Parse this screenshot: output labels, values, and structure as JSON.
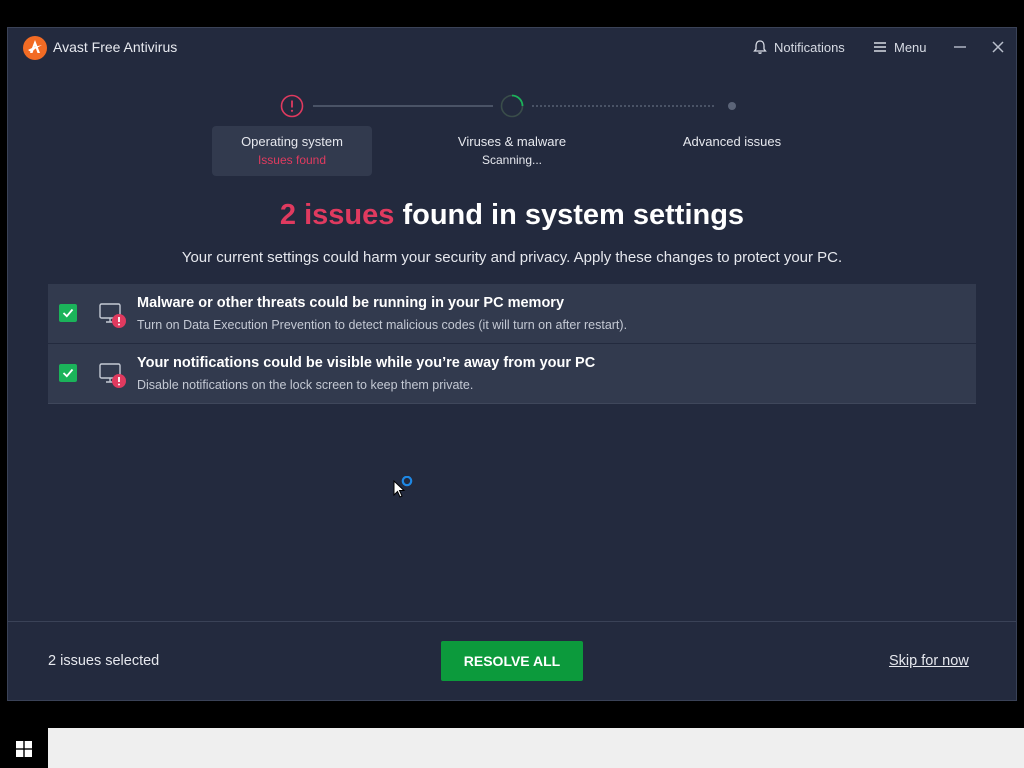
{
  "app": {
    "title": "Avast Free Antivirus"
  },
  "titlebar": {
    "notifications": "Notifications",
    "menu": "Menu"
  },
  "steps": [
    {
      "label": "Operating system",
      "sub": "Issues found",
      "sub_color": "#e03a5f",
      "status": "warning"
    },
    {
      "label": "Viruses & malware",
      "sub": "Scanning...",
      "sub_color": "#e6e8ee",
      "status": "in-progress"
    },
    {
      "label": "Advanced issues",
      "sub": "",
      "status": "pending"
    }
  ],
  "headline": {
    "highlight": "2 issues",
    "rest": " found in system settings"
  },
  "subline": "Your current settings could harm your security and privacy. Apply these changes to protect your PC.",
  "issues": [
    {
      "title": "Malware or other threats could be running in your PC memory",
      "desc": "Turn on Data Execution Prevention to detect malicious codes (it will turn on after restart).",
      "checked": true
    },
    {
      "title": "Your notifications could be visible while you’re away from your PC",
      "desc": "Disable notifications on the lock screen to keep them private.",
      "checked": true
    }
  ],
  "footer": {
    "selected": "2 issues selected",
    "resolve": "RESOLVE ALL",
    "skip": "Skip for now"
  },
  "colors": {
    "background": "#232a3e",
    "panel": "#323a4e",
    "accent_red": "#e03a5f",
    "accent_green": "#0c9a3c",
    "brand_orange": "#f26b24"
  }
}
